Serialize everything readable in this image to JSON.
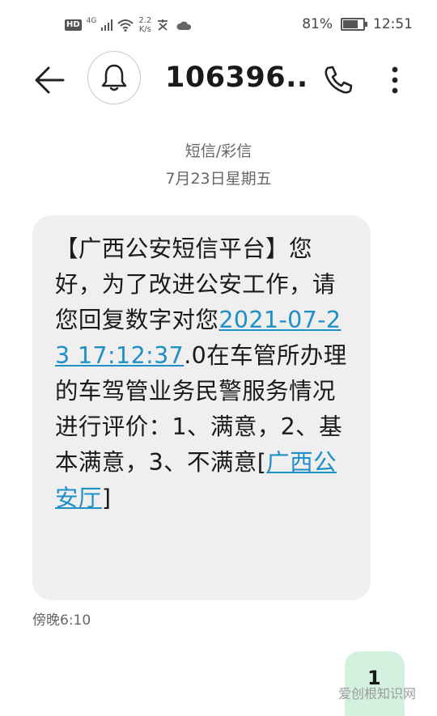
{
  "status_bar": {
    "hd_label": "HD",
    "network_label": "4G",
    "speed_value": "2.2",
    "speed_unit": "K/s",
    "battery_percent": "81%",
    "battery_level": 0.81,
    "time": "12:51"
  },
  "toolbar": {
    "contact_title": "106396..."
  },
  "conversation": {
    "type_label": "短信/彩信",
    "date_label": "7月23日星期五"
  },
  "message": {
    "text_1": "【广西公安短信平台】您好，为了改进公安工作，请您回复数字对您",
    "link_datetime": "2021-07-23 17:12:37",
    "text_2": ".0在车管所办理的车驾管业务民警服务情况进行评价：1、满意，2、基本满意，3、不满意[",
    "link_sender": "广西公安厅",
    "text_3": "]",
    "time": "傍晚6:10"
  },
  "outgoing": {
    "text": "1"
  },
  "watermark": "爱创根知识网",
  "colors": {
    "bubble_in": "#efefef",
    "bubble_out": "#d4f1df",
    "link": "#1f8fc8"
  }
}
